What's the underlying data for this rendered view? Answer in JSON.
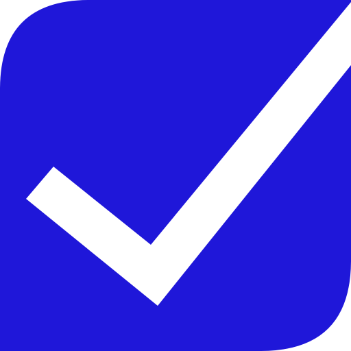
{
  "icon": {
    "name": "checkbox-checked-icon",
    "colors": {
      "background": "#ffffff",
      "box": "#1f17d9",
      "check": "#ffffff"
    }
  }
}
